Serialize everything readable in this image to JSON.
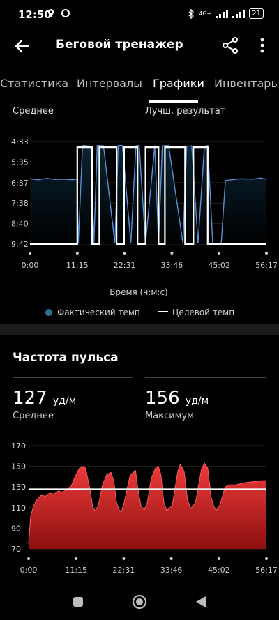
{
  "status_bar": {
    "time": "12:50",
    "network": "4G+",
    "battery": "21"
  },
  "app_bar": {
    "title": "Беговой тренажер",
    "icons": [
      "back-arrow-icon",
      "share-icon",
      "more-vert-icon"
    ]
  },
  "tabs": [
    {
      "label": "Статистика"
    },
    {
      "label": "Интервалы"
    },
    {
      "label": "Графики",
      "active": true
    },
    {
      "label": "Инвентарь"
    }
  ],
  "pace_chart": {
    "top_left_label": "Среднее",
    "top_right_label": "Лучш. результат",
    "legend_actual": "Фактический темп",
    "legend_target": "Целевой темп"
  },
  "heart_rate": {
    "title": "Частота пульса",
    "avg_value": "127",
    "avg_unit": "уд/м",
    "avg_label": "Среднее",
    "max_value": "156",
    "max_unit": "уд/м",
    "max_label": "Максимум"
  },
  "chart_data": [
    {
      "type": "area",
      "xlabel": "Время (ч:м:с)",
      "ylabel": "",
      "y_reversed": true,
      "yticks": [
        "4:33",
        "5:35",
        "6:37",
        "7:38",
        "8:40",
        "9:42"
      ],
      "xticks": [
        "0:00",
        "11:15",
        "22:31",
        "33:46",
        "45:02",
        "56:17"
      ],
      "ylim_seconds": [
        273,
        582
      ],
      "xlim_minutes": [
        0,
        56.28
      ],
      "series": [
        {
          "name": "Фактический темп",
          "color": "#5b8fd6",
          "x": [
            0,
            2,
            4,
            6,
            8,
            10,
            11.2,
            11.5,
            12.5,
            14.5,
            15.2,
            16,
            17.5,
            20.2,
            21,
            22,
            24,
            25.2,
            26,
            27.5,
            29.7,
            30.6,
            31.5,
            33,
            36.4,
            37.3,
            38.5,
            40,
            41.5,
            42.3,
            43.5,
            45.5,
            46.5,
            50,
            53,
            55,
            56.2
          ],
          "y": [
            385,
            388,
            384,
            387,
            386,
            388,
            386,
            580,
            285,
            287,
            580,
            285,
            286,
            580,
            285,
            285,
            580,
            286,
            285,
            580,
            285,
            580,
            286,
            285,
            580,
            287,
            286,
            580,
            288,
            285,
            580,
            582,
            390,
            385,
            386,
            383,
            387
          ]
        },
        {
          "name": "Целевой темп",
          "color": "#ffffff",
          "x": [
            0,
            11.25,
            11.25,
            14.8,
            14.8,
            16.5,
            16.5,
            20.6,
            20.6,
            22.4,
            22.4,
            25.6,
            25.6,
            27.5,
            27.5,
            30.6,
            30.6,
            32.1,
            32.1,
            36.9,
            36.9,
            38.9,
            38.9,
            42.3,
            42.3,
            56.28
          ],
          "y": [
            582,
            582,
            290,
            290,
            582,
            582,
            290,
            290,
            582,
            582,
            290,
            290,
            582,
            582,
            290,
            290,
            582,
            582,
            290,
            290,
            582,
            582,
            290,
            290,
            582,
            582
          ]
        }
      ]
    },
    {
      "type": "area",
      "xlabel": "",
      "ylabel": "",
      "yticks": [
        "170",
        "150",
        "130",
        "110",
        "90",
        "70"
      ],
      "xticks": [
        "0:00",
        "11:15",
        "22:31",
        "33:46",
        "45:02",
        "56:17"
      ],
      "ylim": [
        70,
        170
      ],
      "xlim_minutes": [
        0,
        56.28
      ],
      "threshold": 128,
      "series": [
        {
          "name": "",
          "color": "#e53935",
          "x": [
            0,
            0.5,
            1.2,
            2,
            3,
            4,
            5,
            6,
            7,
            8,
            9,
            10,
            11,
            12,
            13,
            13.5,
            14.5,
            15.2,
            15.8,
            16.5,
            17.5,
            18.5,
            19.5,
            20.2,
            20.8,
            21.4,
            22,
            22.7,
            24,
            25.3,
            25.8,
            26.6,
            27.4,
            28.1,
            29,
            30.1,
            30.7,
            31.3,
            32,
            32.7,
            34,
            35.3,
            35.9,
            36.8,
            37.6,
            38.3,
            39.5,
            40.9,
            41.6,
            42.4,
            43.2,
            44,
            44.6,
            45.3,
            46.5,
            47.5,
            49,
            51,
            53,
            55,
            56.2
          ],
          "y": [
            75,
            102,
            112,
            118,
            122,
            121,
            124,
            123,
            126,
            125,
            127,
            130,
            140,
            148,
            150,
            148,
            128,
            110,
            107,
            112,
            132,
            142,
            144,
            135,
            115,
            108,
            106,
            116,
            141,
            146,
            130,
            111,
            108,
            115,
            138,
            149,
            150,
            142,
            115,
            107,
            112,
            145,
            152,
            145,
            118,
            109,
            115,
            147,
            153,
            148,
            120,
            109,
            108,
            113,
            130,
            132,
            132,
            134,
            135,
            136,
            136
          ]
        }
      ]
    }
  ]
}
